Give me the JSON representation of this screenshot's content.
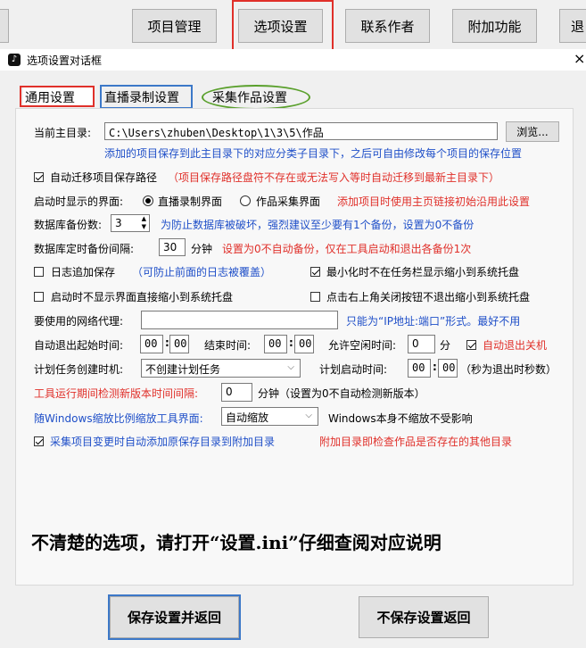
{
  "topnav": {
    "project_manage": "项目管理",
    "option_settings": "选项设置",
    "contact_author": "联系作者",
    "extra_functions": "附加功能",
    "exit": "退"
  },
  "dialog": {
    "title": "选项设置对话框",
    "close": "×"
  },
  "tabs": {
    "general": "通用设置",
    "live_record": "直播录制设置",
    "collect": "采集作品设置"
  },
  "settings": {
    "main_dir_label": "当前主目录:",
    "main_dir_value": "C:\\Users\\zhuben\\Desktop\\1\\3\\5\\作品",
    "browse": "浏览...",
    "main_dir_hint": "添加的项目保存到此主目录下的对应分类子目录下，之后可自由修改每个项目的保存位置",
    "auto_migrate_label": "自动迁移项目保存路径",
    "auto_migrate_hint": "（项目保存路径盘符不存在或无法写入等时自动迁移到最新主目录下）",
    "startup_view_label": "启动时显示的界面:",
    "startup_opt1": "直播录制界面",
    "startup_opt2": "作品采集界面",
    "startup_hint": "添加项目时使用主页链接初始沿用此设置",
    "backup_count_label": "数据库备份数:",
    "backup_count_value": "3",
    "backup_count_hint": "为防止数据库被破坏，强烈建议至少要有1个备份，设置为0不备份",
    "backup_interval_label": "数据库定时备份间隔:",
    "backup_interval_value": "30",
    "backup_interval_unit": "分钟",
    "backup_interval_hint": "设置为0不自动备份，仅在工具启动和退出各备份1次",
    "log_append_label": "日志追加保存",
    "log_append_hint": "（可防止前面的日志被覆盖）",
    "minimize_tray_label": "最小化时不在任务栏显示缩小到系统托盘",
    "start_tray_label": "启动时不显示界面直接缩小到系统托盘",
    "close_tray_label": "点击右上角关闭按钮不退出缩小到系统托盘",
    "proxy_label": "要使用的网络代理:",
    "proxy_value": "",
    "proxy_hint": "只能为“IP地址:端口”形式。最好不用",
    "auto_exit_start_label": "自动退出起始时间:",
    "auto_exit_start_h": "00",
    "auto_exit_start_m": "00",
    "end_time_label": "结束时间:",
    "end_h": "00",
    "end_m": "00",
    "idle_label": "允许空闲时间:",
    "idle_value": "0",
    "idle_unit": "分",
    "auto_shutdown_label": "自动退出关机",
    "task_create_label": "计划任务创建时机:",
    "task_create_value": "不创建计划任务",
    "task_start_label": "计划启动时间:",
    "task_start_h": "00",
    "task_start_m": "00",
    "task_start_hint": "（秒为退出时秒数）",
    "check_version_label": "工具运行期间检测新版本时间间隔:",
    "check_version_value": "0",
    "check_version_hint": "分钟（设置为0不自动检测新版本）",
    "win_scale_label": "随Windows缩放比例缩放工具界面:",
    "win_scale_value": "自动缩放",
    "win_scale_hint": "Windows本身不缩放不受影响",
    "collect_change_label": "采集项目变更时自动添加原保存目录到附加目录",
    "collect_change_hint": "附加目录即检查作品是否存在的其他目录"
  },
  "notice": "不清楚的选项，请打开“设置.ini”仔细查阅对应说明",
  "buttons": {
    "save_return": "保存设置并返回",
    "nosave_return": "不保存设置返回"
  },
  "colors": {
    "red": "#e0302a",
    "blue": "#1f4fc8",
    "green": "#5aa02c"
  }
}
